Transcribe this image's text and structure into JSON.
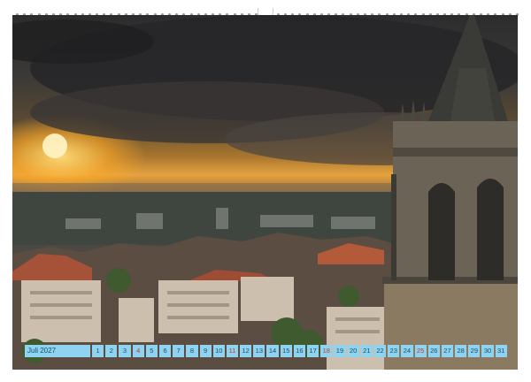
{
  "calendar": {
    "month_label": "Juli 2027",
    "days": [
      "1",
      "2",
      "3",
      "4",
      "5",
      "6",
      "7",
      "8",
      "9",
      "10",
      "11",
      "12",
      "13",
      "14",
      "15",
      "16",
      "17",
      "18",
      "19",
      "20",
      "21",
      "22",
      "23",
      "24",
      "25",
      "26",
      "27",
      "28",
      "29",
      "30",
      "31"
    ],
    "sundays": [
      "4",
      "11",
      "18",
      "25"
    ]
  },
  "colors": {
    "calendar_bg": "#8fd3f0",
    "calendar_text": "#15506b",
    "sunday_text": "#c0392b",
    "sun_glow": "#ffd878"
  }
}
